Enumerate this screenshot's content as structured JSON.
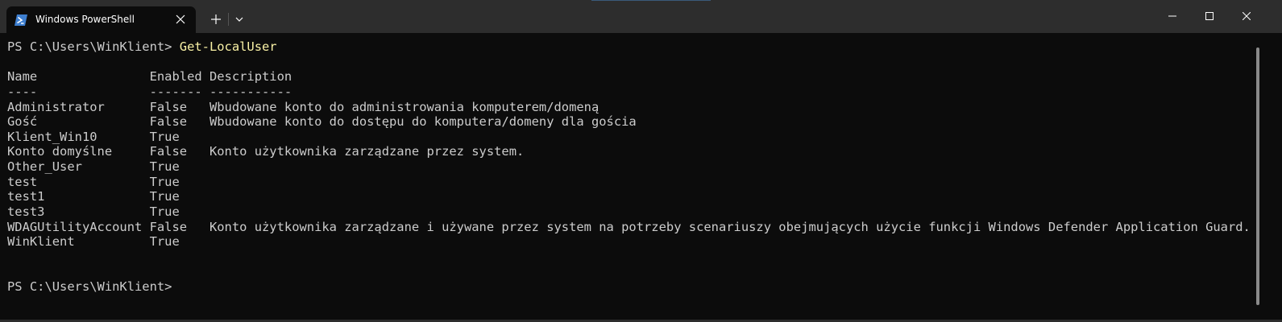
{
  "window": {
    "tab_title": "Windows PowerShell",
    "tab_icon": "powershell-icon",
    "new_tab_icon": "plus-icon",
    "dropdown_icon": "chevron-down-icon",
    "controls": [
      "minimize-icon",
      "maximize-icon",
      "close-icon"
    ],
    "accent_color": "#f9f1a5",
    "background_color": "#0c0c0c",
    "titlebar_color": "#2d2d2d"
  },
  "terminal": {
    "prompt": "PS C:\\Users\\WinKlient> ",
    "command": "Get-LocalUser",
    "table": {
      "columns": [
        {
          "header": "Name",
          "underline": "----"
        },
        {
          "header": "Enabled",
          "underline": "-------"
        },
        {
          "header": "Description",
          "underline": "-----------"
        }
      ],
      "rows": [
        {
          "name": "Administrator",
          "enabled": "False",
          "description": "Wbudowane konto do administrowania komputerem/domeną"
        },
        {
          "name": "Gość",
          "enabled": "False",
          "description": "Wbudowane konto do dostępu do komputera/domeny dla gościa"
        },
        {
          "name": "Klient_Win10",
          "enabled": "True",
          "description": ""
        },
        {
          "name": "Konto domyślne",
          "enabled": "False",
          "description": "Konto użytkownika zarządzane przez system."
        },
        {
          "name": "Other_User",
          "enabled": "True",
          "description": ""
        },
        {
          "name": "test",
          "enabled": "True",
          "description": ""
        },
        {
          "name": "test1",
          "enabled": "True",
          "description": ""
        },
        {
          "name": "test3",
          "enabled": "True",
          "description": ""
        },
        {
          "name": "WDAGUtilityAccount",
          "enabled": "False",
          "description": "Konto użytkownika zarządzane i używane przez system na potrzeby scenariuszy obejmujących użycie funkcji Windows Defender Application Guard."
        },
        {
          "name": "WinKlient",
          "enabled": "True",
          "description": ""
        }
      ]
    },
    "final_prompt": "PS C:\\Users\\WinKlient>"
  }
}
